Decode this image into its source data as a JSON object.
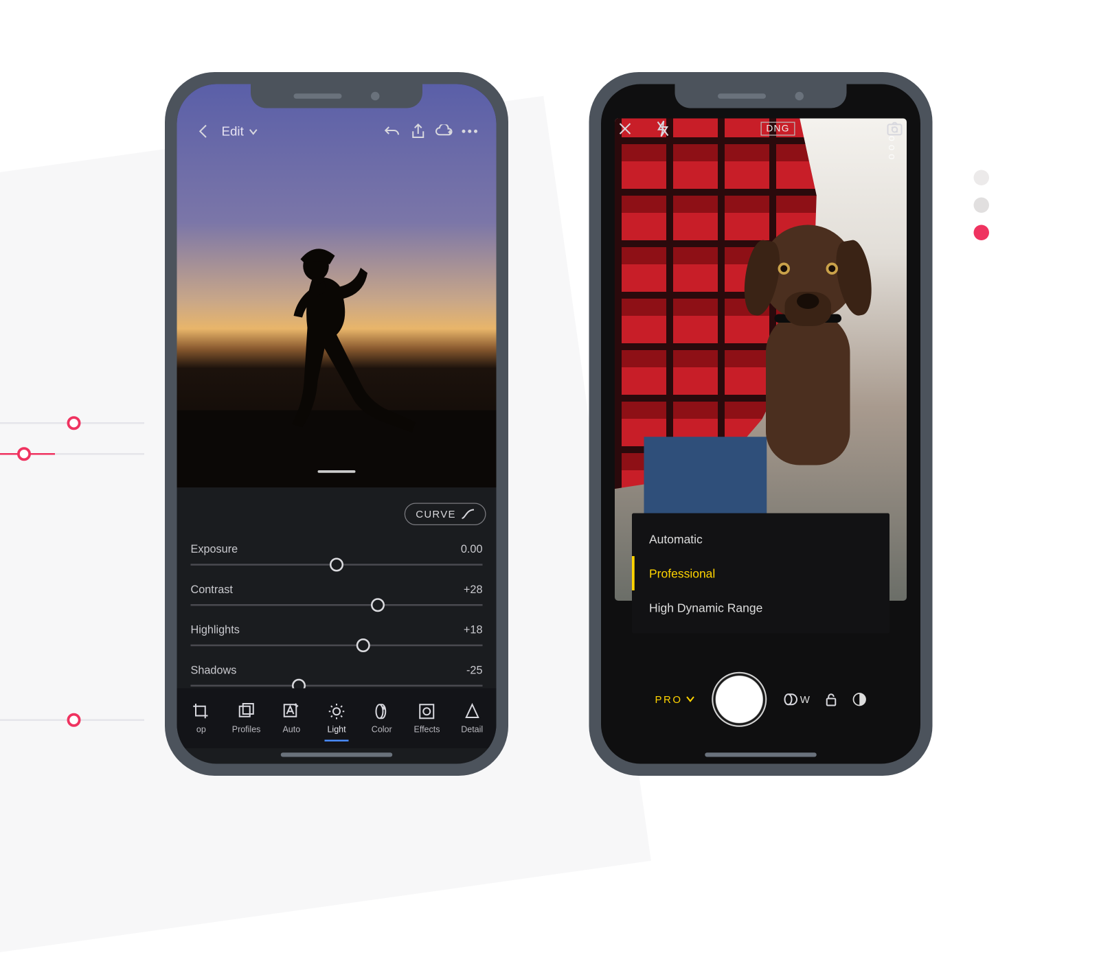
{
  "phone1": {
    "topbar": {
      "back_icon": "chevron-left",
      "title": "Edit",
      "actions": [
        "undo-icon",
        "share-icon",
        "cloud-add-icon",
        "more-icon"
      ]
    },
    "curve_label": "CURVE",
    "sliders": [
      {
        "label": "Exposure",
        "value": "0.00",
        "pos": 50
      },
      {
        "label": "Contrast",
        "value": "+28",
        "pos": 64
      },
      {
        "label": "Highlights",
        "value": "+18",
        "pos": 59
      },
      {
        "label": "Shadows",
        "value": "-25",
        "pos": 37
      }
    ],
    "tabs": [
      {
        "label": "op",
        "icon": "crop",
        "name": "tab-crop"
      },
      {
        "label": "Profiles",
        "icon": "profiles",
        "name": "tab-profiles"
      },
      {
        "label": "Auto",
        "icon": "auto",
        "name": "tab-auto"
      },
      {
        "label": "Light",
        "icon": "light",
        "name": "tab-light",
        "active": true
      },
      {
        "label": "Color",
        "icon": "color",
        "name": "tab-color"
      },
      {
        "label": "Effects",
        "icon": "effects",
        "name": "tab-effects"
      },
      {
        "label": "Detail",
        "icon": "detail",
        "name": "tab-detail"
      }
    ]
  },
  "phone2": {
    "topbar": {
      "format": "DNG"
    },
    "modes": [
      {
        "label": "Automatic"
      },
      {
        "label": "Professional",
        "selected": true
      },
      {
        "label": "High Dynamic Range"
      }
    ],
    "cam": {
      "mode_short": "PRO",
      "wide": "W"
    }
  },
  "deco": {
    "dot_colors": [
      "#eceaea",
      "#e1dfdf",
      "#ef3360"
    ]
  }
}
